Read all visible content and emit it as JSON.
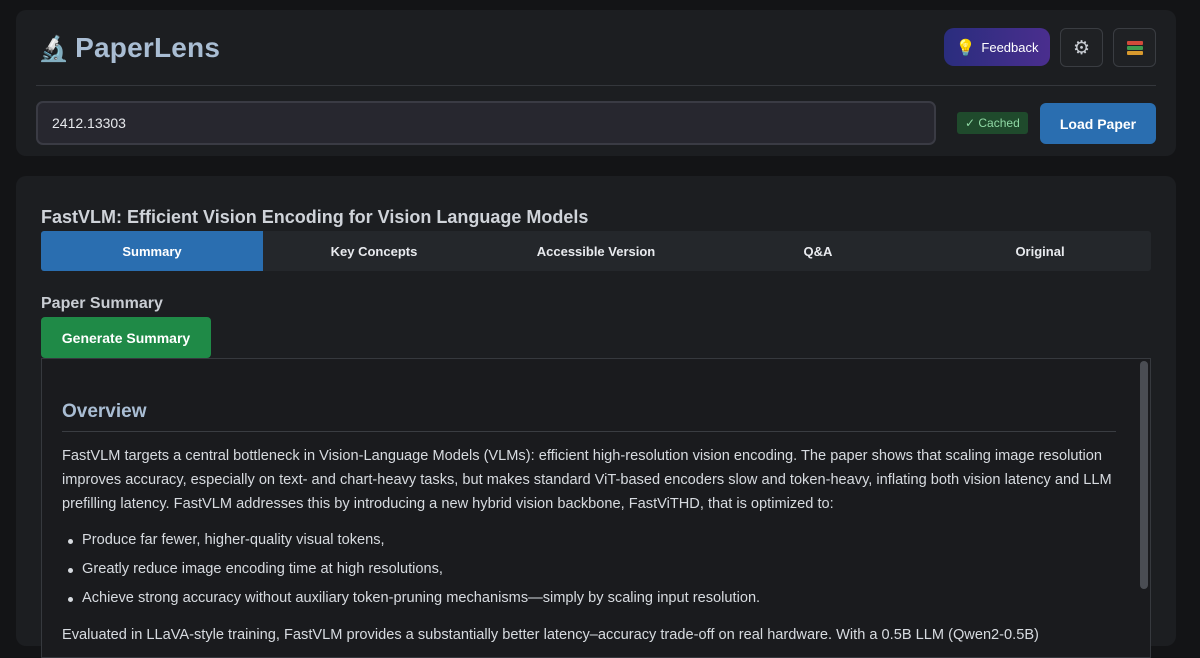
{
  "brand": {
    "emoji": "🔬",
    "title": "PaperLens"
  },
  "header": {
    "feedback_icon": "💡",
    "feedback_label": "Feedback",
    "settings_icon": "⚙",
    "library_icon": "books-icon"
  },
  "search": {
    "value": "2412.13303",
    "cached_label": "✓ Cached",
    "load_label": "Load Paper"
  },
  "paper": {
    "title": "FastVLM: Efficient Vision Encoding for Vision Language Models"
  },
  "tabs": [
    {
      "label": "Summary",
      "active": true
    },
    {
      "label": "Key Concepts",
      "active": false
    },
    {
      "label": "Accessible Version",
      "active": false
    },
    {
      "label": "Q&A",
      "active": false
    },
    {
      "label": "Original",
      "active": false
    }
  ],
  "summary": {
    "heading": "Paper Summary",
    "generate_label": "Generate Summary",
    "overview_title": "Overview",
    "paragraph": "FastVLM targets a central bottleneck in Vision-Language Models (VLMs): efficient high-resolution vision encoding. The paper shows that scaling image resolution improves accuracy, especially on text- and chart-heavy tasks, but makes standard ViT-based encoders slow and token-heavy, inflating both vision latency and LLM prefilling latency. FastVLM addresses this by introducing a new hybrid vision backbone, FastViTHD, that is optimized to:",
    "bullets": [
      "Produce far fewer, higher-quality visual tokens,",
      "Greatly reduce image encoding time at high resolutions,",
      "Achieve strong accuracy without auxiliary token-pruning mechanisms—simply by scaling input resolution."
    ],
    "paragraph2": "Evaluated in LLaVA-style training, FastVLM provides a substantially better latency–accuracy trade-off on real hardware. With a 0.5B LLM (Qwen2-0.5B)"
  },
  "colors": {
    "accent": "#2a6eb0",
    "success": "#1f8a47",
    "feedback_gradient_start": "#2a2d7e",
    "feedback_gradient_end": "#4a2e8e",
    "brand_text": "#a9bdd3"
  }
}
